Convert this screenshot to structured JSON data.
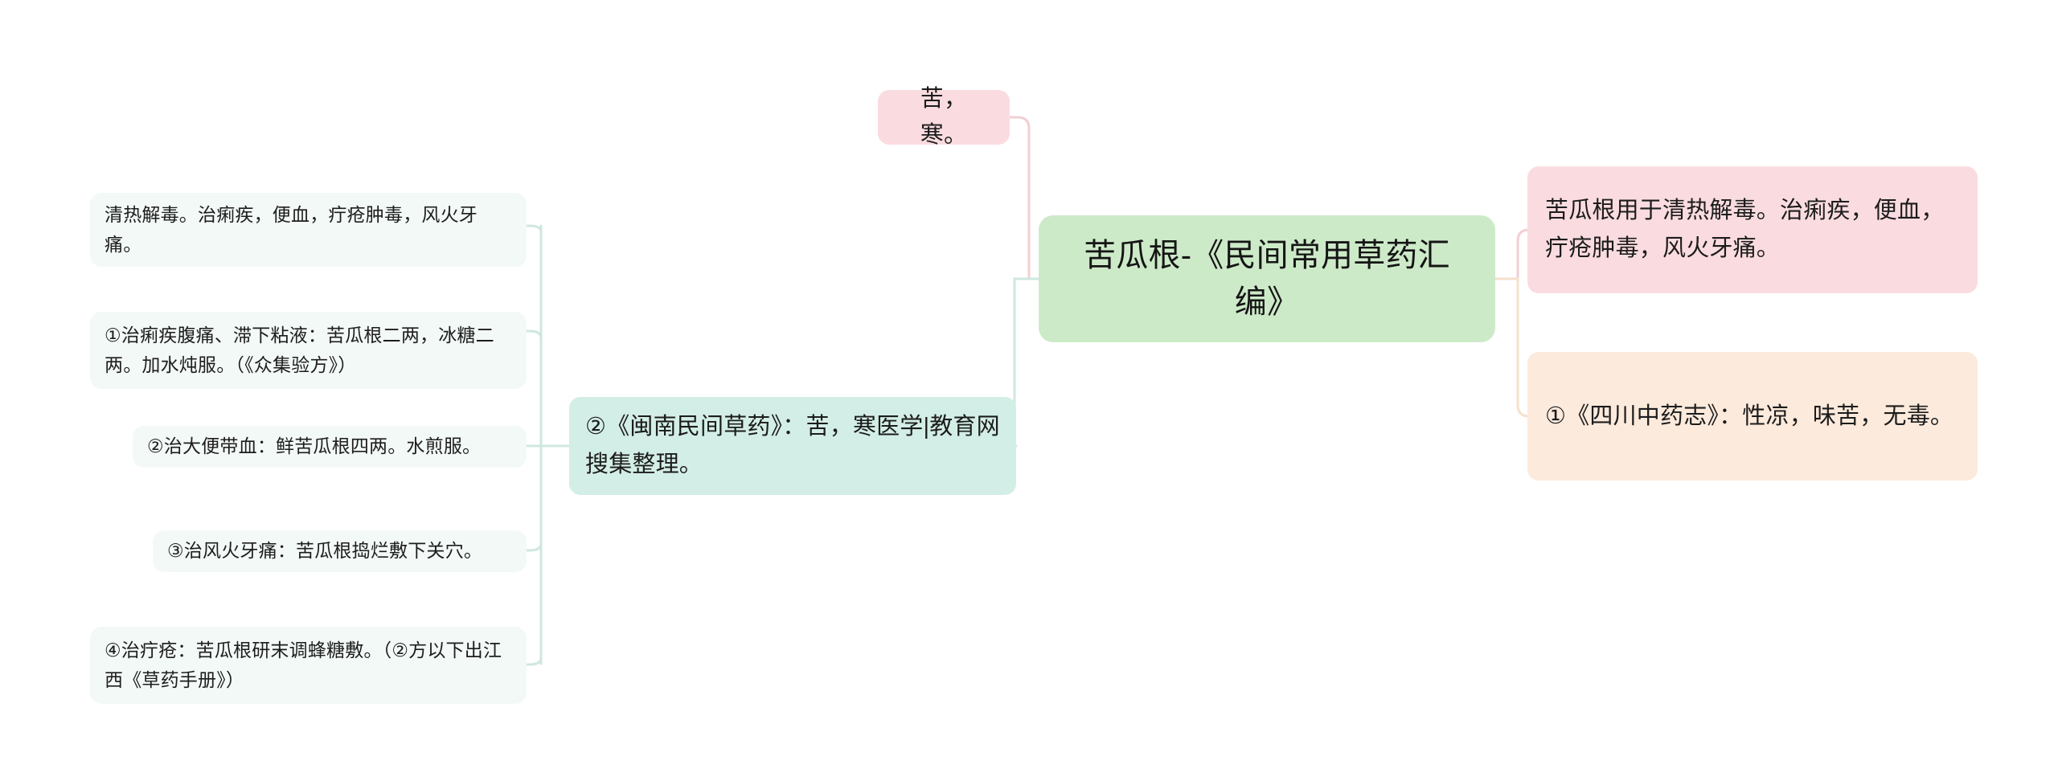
{
  "diagram": {
    "type": "mind-map",
    "title": "苦瓜根-《民间常用草药汇编》",
    "colors": {
      "root_bg": "#cdeac8",
      "pink_bg": "#fadce0",
      "peach_bg": "#fceadc",
      "teal_bg": "#d3eee6",
      "leaf_bg": "#f3f9f7",
      "pink_line": "#f2cfd3",
      "peach_line": "#f6e0cd",
      "teal_line": "#cfe7e0",
      "text": "#1c1c1c",
      "canvas": "#ffffff"
    }
  },
  "root": {
    "label": "苦瓜根-《民间常用草药汇编》"
  },
  "branches": {
    "top": {
      "label": "苦，寒。"
    },
    "right": [
      {
        "id": "right-1",
        "label": "苦瓜根用于清热解毒。治痢疾，便血，疔疮肿毒，风火牙痛。"
      },
      {
        "id": "right-2",
        "label": "①《四川中药志》：性凉，味苦，无毒。"
      }
    ],
    "middle": {
      "label": "②《闽南民间草药》：苦，寒医学|教育网搜集整理。"
    },
    "left": [
      {
        "id": "left-1",
        "label": "清热解毒。治痢疾，便血，疔疮肿毒，风火牙痛。"
      },
      {
        "id": "left-2",
        "label": "①治痢疾腹痛、滞下粘液：苦瓜根二两，冰糖二两。加水炖服。（《众集验方》）"
      },
      {
        "id": "left-3",
        "label": "②治大便带血：鲜苦瓜根四两。水煎服。"
      },
      {
        "id": "left-4",
        "label": "③治风火牙痛：苦瓜根捣烂敷下关穴。"
      },
      {
        "id": "left-5",
        "label": "④治疔疮：苦瓜根研末调蜂糖敷。（②方以下出江西《草药手册》）"
      }
    ]
  }
}
